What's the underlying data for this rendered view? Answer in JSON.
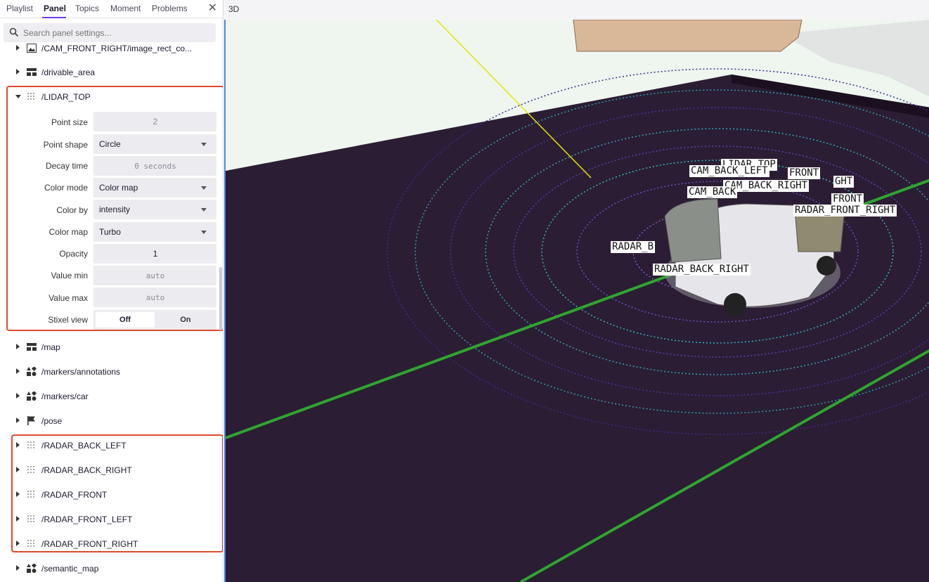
{
  "tabs": [
    {
      "label": "Playlist"
    },
    {
      "label": "Panel"
    },
    {
      "label": "Topics"
    },
    {
      "label": "Moment"
    },
    {
      "label": "Problems"
    }
  ],
  "search": {
    "placeholder": "Search panel settings..."
  },
  "topics": [
    {
      "label": "/CAM_FRONT_RIGHT/image_rect_co...",
      "icon": "image-icon"
    },
    {
      "label": "/drivable_area",
      "icon": "grid-icon"
    },
    {
      "label": "/LIDAR_TOP",
      "icon": "points-icon"
    },
    {
      "label": "/map",
      "icon": "grid-icon"
    },
    {
      "label": "/markers/annotations",
      "icon": "shapes-icon"
    },
    {
      "label": "/markers/car",
      "icon": "shapes-icon"
    },
    {
      "label": "/pose",
      "icon": "flag-icon"
    },
    {
      "label": "/RADAR_BACK_LEFT",
      "icon": "points-icon"
    },
    {
      "label": "/RADAR_BACK_RIGHT",
      "icon": "points-icon"
    },
    {
      "label": "/RADAR_FRONT",
      "icon": "points-icon"
    },
    {
      "label": "/RADAR_FRONT_LEFT",
      "icon": "points-icon"
    },
    {
      "label": "/RADAR_FRONT_RIGHT",
      "icon": "points-icon"
    },
    {
      "label": "/semantic_map",
      "icon": "shapes-icon"
    }
  ],
  "lidar_settings": {
    "point_size": {
      "label": "Point size",
      "value": "2"
    },
    "point_shape": {
      "label": "Point shape",
      "value": "Circle"
    },
    "decay_time": {
      "label": "Decay time",
      "value": "0 seconds"
    },
    "color_mode": {
      "label": "Color mode",
      "value": "Color map"
    },
    "color_by": {
      "label": "Color by",
      "value": "intensity"
    },
    "color_map": {
      "label": "Color map",
      "value": "Turbo"
    },
    "opacity": {
      "label": "Opacity",
      "value": "1"
    },
    "value_min": {
      "label": "Value min",
      "value": "auto"
    },
    "value_max": {
      "label": "Value max",
      "value": "auto"
    },
    "stixel_view": {
      "label": "Stixel view",
      "off": "Off",
      "on": "On",
      "selected": "Off"
    }
  },
  "viewport": {
    "title": "3D",
    "frame_labels": [
      "LIDAR_TOP",
      "CAM_BACK_LEFT",
      "FRONT",
      "CAM_BACK_RIGHT",
      "GHT",
      "CAM_BACK",
      "FRONT",
      "RADAR_FRONT_RIGHT",
      "RADAR_B",
      "RADAR_BACK_RIGHT"
    ]
  },
  "colors": {
    "accent": "#6f3be8",
    "highlight_border": "#e0492d",
    "ground": "#2a1a33",
    "lane_line": "#2fa52f",
    "axis_line": "#e6e600"
  }
}
